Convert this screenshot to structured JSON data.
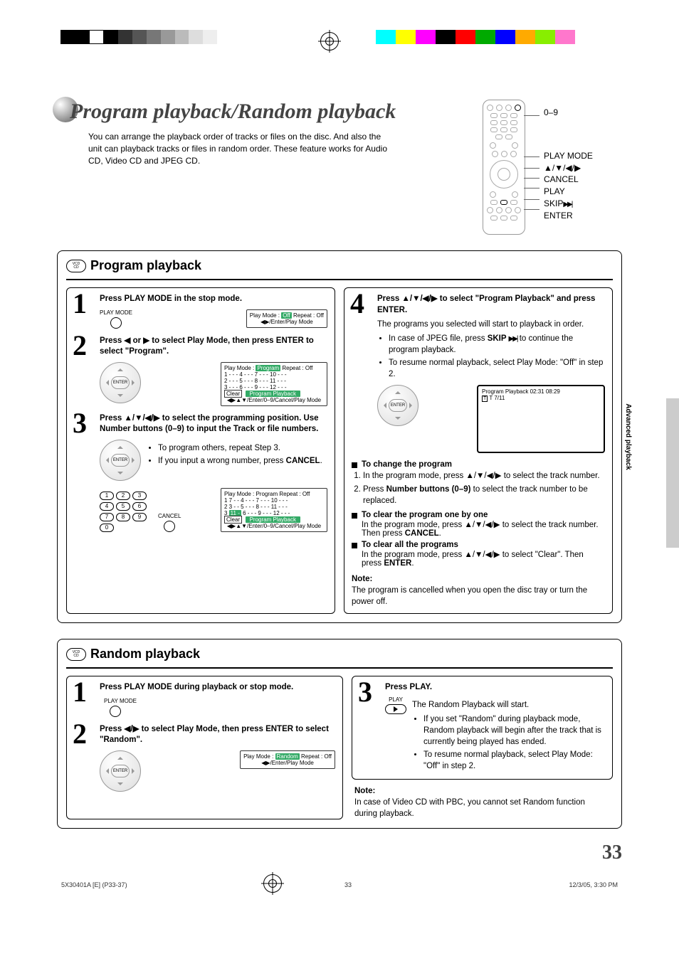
{
  "header": {
    "title": "Program playback/Random playback",
    "intro": "You can arrange the playback order of tracks or files on the disc. And also the unit can playback tracks or files in random order. These feature works for Audio CD, Video CD and JPEG CD."
  },
  "remote_labels": {
    "nums": "0–9",
    "play_mode": "PLAY MODE",
    "arrows": "▲/▼/◀/▶",
    "cancel": "CANCEL",
    "play": "PLAY",
    "skip": "SKIP",
    "enter": "ENTER"
  },
  "side_tab": "Advanced playback",
  "program": {
    "title": "Program playback",
    "badge_top": "VCD",
    "badge_bottom": "CD",
    "step1": {
      "num": "1",
      "head": "Press PLAY MODE in the stop mode.",
      "small_label": "PLAY MODE",
      "osd_line1_pre": "Play Mode : ",
      "osd_off": "Off",
      "osd_line1_post": "    Repeat  :   Off",
      "osd_line2": "◀▶/Enter/Play Mode"
    },
    "step2": {
      "num": "2",
      "head": "Press ◀ or ▶ to select Play Mode, then press ENTER to select \"Program\".",
      "enter_label": "ENTER",
      "osd_header_pre": "Play Mode  :  ",
      "osd_program": "Program",
      "osd_header_post": "    Repeat    :    Off",
      "grid": [
        "1 - - -    4 - - -    7 - - -    10 - - -",
        "2 - - -    5 - - -    8 - - -    11 - - -",
        "3 - - -    6 - - -    9 - - -    12 - - -"
      ],
      "osd_clear": "Clear",
      "osd_pp": "Program Playback",
      "osd_foot": "◀▶▲▼/Enter/0–9/Cancel/Play Mode"
    },
    "step3": {
      "num": "3",
      "head": "Press ▲/▼/◀/▶ to select the programming position. Use Number buttons (0–9) to input the Track or file numbers.",
      "bullet1": "To program others, repeat Step 3.",
      "bullet2_pre": "If you input a wrong number, press ",
      "bullet2_bold": "CANCEL",
      "bullet2_post": ".",
      "enter_label": "ENTER",
      "cancel_label": "CANCEL",
      "np": [
        "1",
        "2",
        "3",
        "4",
        "5",
        "6",
        "7",
        "8",
        "9",
        "0"
      ],
      "osd_header_pre": "Play Mode  :  Program    Repeat    :    Off",
      "grid": [
        "1  7 - -    4 - - -    7 - - -    10 - - -",
        "2  3 - -    5 - - -    8 - - -    11 - - -"
      ],
      "grid_hl_row_pre": "3 ",
      "grid_hl_cell": "11 -",
      "grid_hl_row_post": "   6 - - -    9 - - -    12 - - -",
      "osd_clear": "Clear",
      "osd_pp": "Program Playback",
      "osd_foot": "◀▶▲▼/Enter/0–9/Cancel/Play Mode"
    },
    "step4": {
      "num": "4",
      "head": "Press ▲/▼/◀/▶ to select \"Program Playback\" and press ENTER.",
      "body": "The programs you selected will start to playback in order.",
      "bullet1_pre": "In case of JPEG file, press ",
      "bullet1_bold": "SKIP ",
      "bullet1_post": " to continue the program playback.",
      "bullet2": "To resume normal playback, select Play Mode: \"Off\" in step 2.",
      "enter_label": "ENTER",
      "tv_line1": "Program Playback        02:31  08:29",
      "tv_line2": "T 7/11"
    },
    "change": {
      "h": "To change the program",
      "li1": "In the program mode, press ▲/▼/◀/▶ to select the track number.",
      "li2_pre": "Press ",
      "li2_bold": "Number buttons (0–9)",
      "li2_post": " to select the track number to be replaced."
    },
    "clear_one": {
      "h": "To clear the program one by one",
      "body_pre": "In the program mode, press ▲/▼/◀/▶ to select the track number. Then press ",
      "body_bold": "CANCEL",
      "body_post": "."
    },
    "clear_all": {
      "h": "To clear all the programs",
      "body_pre": "In the program mode, press ▲/▼/◀/▶ to select \"Clear\". Then press ",
      "body_bold": "ENTER",
      "body_post": "."
    },
    "note": {
      "label": "Note:",
      "body": "The program is cancelled when you open the disc tray or turn the power off."
    }
  },
  "random": {
    "title": "Random playback",
    "badge_top": "VCD",
    "badge_bottom": "CD",
    "step1": {
      "num": "1",
      "head": "Press PLAY MODE during playback or stop mode.",
      "small_label": "PLAY MODE"
    },
    "step2": {
      "num": "2",
      "head": "Press ◀/▶ to select Play Mode, then press ENTER to select \"Random\".",
      "enter_label": "ENTER",
      "osd_pre": "Play Mode : ",
      "osd_random": "Random",
      "osd_post": " Repeat  :  Off",
      "osd_foot": "◀▶/Enter/Play Mode"
    },
    "step3": {
      "num": "3",
      "head": "Press PLAY.",
      "play_label": "PLAY",
      "body": "The Random Playback will start.",
      "bullet1": "If you set \"Random\" during playback mode, Random playback will begin after the track that is currently being played has ended.",
      "bullet2": "To resume normal playback, select Play Mode: \"Off\" in step 2."
    },
    "note": {
      "label": "Note:",
      "body": "In case of Video CD with PBC, you cannot set Random function during playback."
    }
  },
  "page_number": "33",
  "footer": {
    "left": "5X30401A [E] (P33-37)",
    "center": "33",
    "right": "12/3/05, 3:30 PM"
  }
}
